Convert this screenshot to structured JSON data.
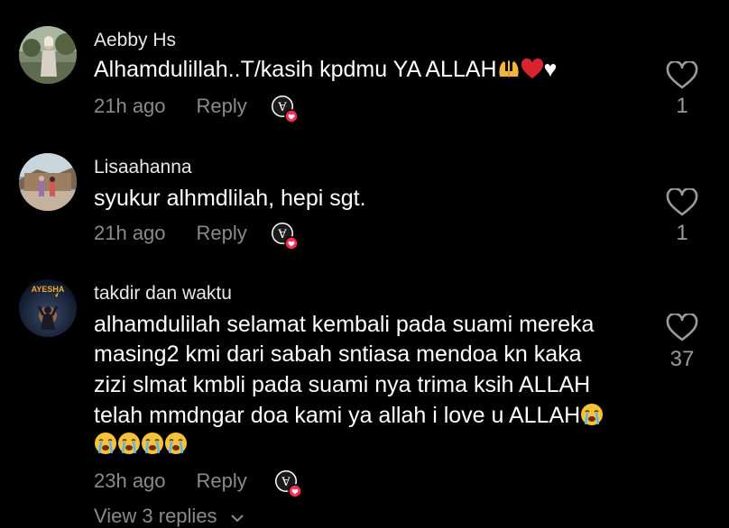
{
  "comments": [
    {
      "username": "Aebby Hs",
      "text_prefix": "Alhamdulillah..T/kasih kpdmu YA ALLAH",
      "text_suffix": "♥",
      "time": "21h ago",
      "reply_label": "Reply",
      "likes": "1"
    },
    {
      "username": "Lisaahanna",
      "text": "syukur alhmdlilah, hepi sgt.",
      "time": "21h ago",
      "reply_label": "Reply",
      "likes": "1"
    },
    {
      "username": "takdir dan waktu",
      "avatar_text": "AYESHA",
      "lines": [
        "alhamdulilah selamat kembali pada suami mereka",
        "masing2 kmi dari sabah sntiasa mendoa kn kaka",
        "zizi slmat kmbli pada suami nya trima ksih ALLAH",
        "telah mmdngar doa kami ya allah i love u ALLAH"
      ],
      "time": "23h ago",
      "reply_label": "Reply",
      "likes": "37"
    }
  ],
  "view_replies": "View 3 replies",
  "colors": {
    "background": "#000000",
    "secondary_text": "#8a8a8a",
    "badge_red": "#fe2c55"
  }
}
